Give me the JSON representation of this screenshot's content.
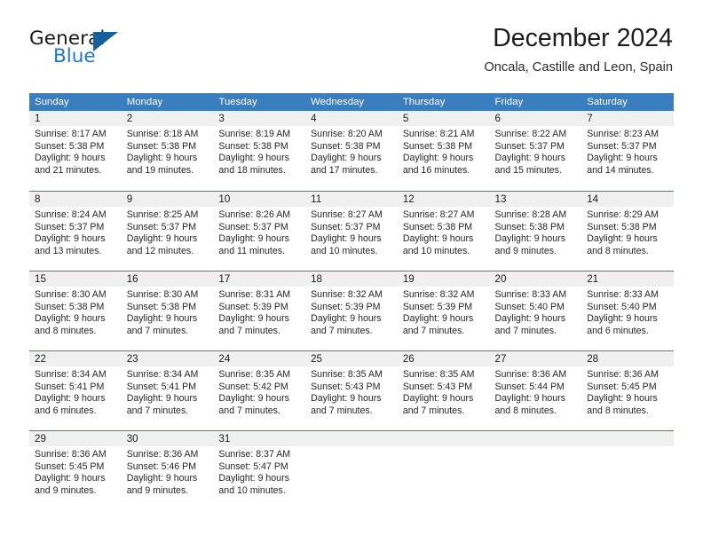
{
  "brand": {
    "name_part1": "General",
    "name_part2": "Blue",
    "triangle_color": "#15619e",
    "blue_color": "#2176c7"
  },
  "header": {
    "month_title": "December 2024",
    "location": "Oncala, Castille and Leon, Spain"
  },
  "theme": {
    "header_blue": "#3a7ebf",
    "day_band_gray": "#f0f0f0",
    "text_color": "#252525"
  },
  "weekdays": [
    "Sunday",
    "Monday",
    "Tuesday",
    "Wednesday",
    "Thursday",
    "Friday",
    "Saturday"
  ],
  "weeks": [
    [
      {
        "day": "1",
        "sunrise": "Sunrise: 8:17 AM",
        "sunset": "Sunset: 5:38 PM",
        "daylight_line1": "Daylight: 9 hours",
        "daylight_line2": "and 21 minutes."
      },
      {
        "day": "2",
        "sunrise": "Sunrise: 8:18 AM",
        "sunset": "Sunset: 5:38 PM",
        "daylight_line1": "Daylight: 9 hours",
        "daylight_line2": "and 19 minutes."
      },
      {
        "day": "3",
        "sunrise": "Sunrise: 8:19 AM",
        "sunset": "Sunset: 5:38 PM",
        "daylight_line1": "Daylight: 9 hours",
        "daylight_line2": "and 18 minutes."
      },
      {
        "day": "4",
        "sunrise": "Sunrise: 8:20 AM",
        "sunset": "Sunset: 5:38 PM",
        "daylight_line1": "Daylight: 9 hours",
        "daylight_line2": "and 17 minutes."
      },
      {
        "day": "5",
        "sunrise": "Sunrise: 8:21 AM",
        "sunset": "Sunset: 5:38 PM",
        "daylight_line1": "Daylight: 9 hours",
        "daylight_line2": "and 16 minutes."
      },
      {
        "day": "6",
        "sunrise": "Sunrise: 8:22 AM",
        "sunset": "Sunset: 5:37 PM",
        "daylight_line1": "Daylight: 9 hours",
        "daylight_line2": "and 15 minutes."
      },
      {
        "day": "7",
        "sunrise": "Sunrise: 8:23 AM",
        "sunset": "Sunset: 5:37 PM",
        "daylight_line1": "Daylight: 9 hours",
        "daylight_line2": "and 14 minutes."
      }
    ],
    [
      {
        "day": "8",
        "sunrise": "Sunrise: 8:24 AM",
        "sunset": "Sunset: 5:37 PM",
        "daylight_line1": "Daylight: 9 hours",
        "daylight_line2": "and 13 minutes."
      },
      {
        "day": "9",
        "sunrise": "Sunrise: 8:25 AM",
        "sunset": "Sunset: 5:37 PM",
        "daylight_line1": "Daylight: 9 hours",
        "daylight_line2": "and 12 minutes."
      },
      {
        "day": "10",
        "sunrise": "Sunrise: 8:26 AM",
        "sunset": "Sunset: 5:37 PM",
        "daylight_line1": "Daylight: 9 hours",
        "daylight_line2": "and 11 minutes."
      },
      {
        "day": "11",
        "sunrise": "Sunrise: 8:27 AM",
        "sunset": "Sunset: 5:37 PM",
        "daylight_line1": "Daylight: 9 hours",
        "daylight_line2": "and 10 minutes."
      },
      {
        "day": "12",
        "sunrise": "Sunrise: 8:27 AM",
        "sunset": "Sunset: 5:38 PM",
        "daylight_line1": "Daylight: 9 hours",
        "daylight_line2": "and 10 minutes."
      },
      {
        "day": "13",
        "sunrise": "Sunrise: 8:28 AM",
        "sunset": "Sunset: 5:38 PM",
        "daylight_line1": "Daylight: 9 hours",
        "daylight_line2": "and 9 minutes."
      },
      {
        "day": "14",
        "sunrise": "Sunrise: 8:29 AM",
        "sunset": "Sunset: 5:38 PM",
        "daylight_line1": "Daylight: 9 hours",
        "daylight_line2": "and 8 minutes."
      }
    ],
    [
      {
        "day": "15",
        "sunrise": "Sunrise: 8:30 AM",
        "sunset": "Sunset: 5:38 PM",
        "daylight_line1": "Daylight: 9 hours",
        "daylight_line2": "and 8 minutes."
      },
      {
        "day": "16",
        "sunrise": "Sunrise: 8:30 AM",
        "sunset": "Sunset: 5:38 PM",
        "daylight_line1": "Daylight: 9 hours",
        "daylight_line2": "and 7 minutes."
      },
      {
        "day": "17",
        "sunrise": "Sunrise: 8:31 AM",
        "sunset": "Sunset: 5:39 PM",
        "daylight_line1": "Daylight: 9 hours",
        "daylight_line2": "and 7 minutes."
      },
      {
        "day": "18",
        "sunrise": "Sunrise: 8:32 AM",
        "sunset": "Sunset: 5:39 PM",
        "daylight_line1": "Daylight: 9 hours",
        "daylight_line2": "and 7 minutes."
      },
      {
        "day": "19",
        "sunrise": "Sunrise: 8:32 AM",
        "sunset": "Sunset: 5:39 PM",
        "daylight_line1": "Daylight: 9 hours",
        "daylight_line2": "and 7 minutes."
      },
      {
        "day": "20",
        "sunrise": "Sunrise: 8:33 AM",
        "sunset": "Sunset: 5:40 PM",
        "daylight_line1": "Daylight: 9 hours",
        "daylight_line2": "and 7 minutes."
      },
      {
        "day": "21",
        "sunrise": "Sunrise: 8:33 AM",
        "sunset": "Sunset: 5:40 PM",
        "daylight_line1": "Daylight: 9 hours",
        "daylight_line2": "and 6 minutes."
      }
    ],
    [
      {
        "day": "22",
        "sunrise": "Sunrise: 8:34 AM",
        "sunset": "Sunset: 5:41 PM",
        "daylight_line1": "Daylight: 9 hours",
        "daylight_line2": "and 6 minutes."
      },
      {
        "day": "23",
        "sunrise": "Sunrise: 8:34 AM",
        "sunset": "Sunset: 5:41 PM",
        "daylight_line1": "Daylight: 9 hours",
        "daylight_line2": "and 7 minutes."
      },
      {
        "day": "24",
        "sunrise": "Sunrise: 8:35 AM",
        "sunset": "Sunset: 5:42 PM",
        "daylight_line1": "Daylight: 9 hours",
        "daylight_line2": "and 7 minutes."
      },
      {
        "day": "25",
        "sunrise": "Sunrise: 8:35 AM",
        "sunset": "Sunset: 5:43 PM",
        "daylight_line1": "Daylight: 9 hours",
        "daylight_line2": "and 7 minutes."
      },
      {
        "day": "26",
        "sunrise": "Sunrise: 8:35 AM",
        "sunset": "Sunset: 5:43 PM",
        "daylight_line1": "Daylight: 9 hours",
        "daylight_line2": "and 7 minutes."
      },
      {
        "day": "27",
        "sunrise": "Sunrise: 8:36 AM",
        "sunset": "Sunset: 5:44 PM",
        "daylight_line1": "Daylight: 9 hours",
        "daylight_line2": "and 8 minutes."
      },
      {
        "day": "28",
        "sunrise": "Sunrise: 8:36 AM",
        "sunset": "Sunset: 5:45 PM",
        "daylight_line1": "Daylight: 9 hours",
        "daylight_line2": "and 8 minutes."
      }
    ],
    [
      {
        "day": "29",
        "sunrise": "Sunrise: 8:36 AM",
        "sunset": "Sunset: 5:45 PM",
        "daylight_line1": "Daylight: 9 hours",
        "daylight_line2": "and 9 minutes."
      },
      {
        "day": "30",
        "sunrise": "Sunrise: 8:36 AM",
        "sunset": "Sunset: 5:46 PM",
        "daylight_line1": "Daylight: 9 hours",
        "daylight_line2": "and 9 minutes."
      },
      {
        "day": "31",
        "sunrise": "Sunrise: 8:37 AM",
        "sunset": "Sunset: 5:47 PM",
        "daylight_line1": "Daylight: 9 hours",
        "daylight_line2": "and 10 minutes."
      },
      {
        "day": "",
        "sunrise": "",
        "sunset": "",
        "daylight_line1": "",
        "daylight_line2": ""
      },
      {
        "day": "",
        "sunrise": "",
        "sunset": "",
        "daylight_line1": "",
        "daylight_line2": ""
      },
      {
        "day": "",
        "sunrise": "",
        "sunset": "",
        "daylight_line1": "",
        "daylight_line2": ""
      },
      {
        "day": "",
        "sunrise": "",
        "sunset": "",
        "daylight_line1": "",
        "daylight_line2": ""
      }
    ]
  ]
}
